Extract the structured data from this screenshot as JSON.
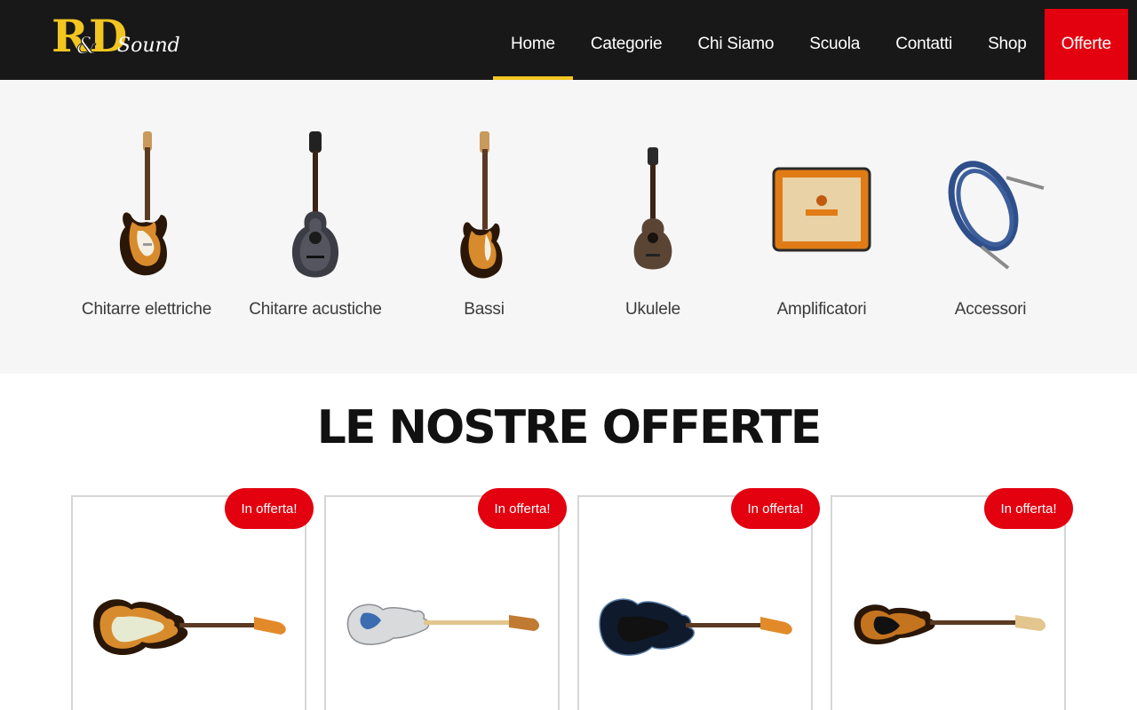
{
  "header": {
    "logo_text": "R&D Sound",
    "nav": [
      {
        "label": "Home"
      },
      {
        "label": "Categorie"
      },
      {
        "label": "Chi Siamo"
      },
      {
        "label": "Scuola"
      },
      {
        "label": "Contatti"
      },
      {
        "label": "Shop"
      },
      {
        "label": "Offerte"
      }
    ],
    "active_item": "Home",
    "accent_color": "#f2c521",
    "offers_color": "#e3000f"
  },
  "categories": [
    {
      "label": "Chitarre elettriche",
      "icon": "electric-guitar-icon"
    },
    {
      "label": "Chitarre acustiche",
      "icon": "acoustic-guitar-icon"
    },
    {
      "label": "Bassi",
      "icon": "bass-guitar-icon"
    },
    {
      "label": "Ukulele",
      "icon": "ukulele-icon"
    },
    {
      "label": "Amplificatori",
      "icon": "amplifier-icon"
    },
    {
      "label": "Accessori",
      "icon": "cable-icon"
    }
  ],
  "offers": {
    "title": "LE NOSTRE OFFERTE",
    "products": [
      {
        "badge": "In offerta!",
        "image": "sunburst-electric-guitar"
      },
      {
        "badge": "In offerta!",
        "image": "white-bass-guitar"
      },
      {
        "badge": "In offerta!",
        "image": "black-electric-guitar"
      },
      {
        "badge": "In offerta!",
        "image": "sunburst-bass-guitar"
      }
    ]
  }
}
